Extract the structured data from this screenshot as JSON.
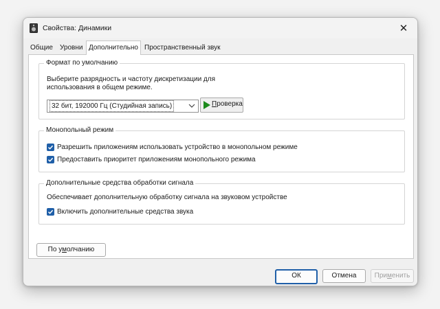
{
  "window": {
    "title": "Свойства: Динамики",
    "close_glyph": "✕"
  },
  "tabs": [
    {
      "label": "Общие"
    },
    {
      "label": "Уровни"
    },
    {
      "label": "Дополнительно",
      "active": true
    },
    {
      "label": "Пространственный звук"
    }
  ],
  "format_group": {
    "legend": "Формат по умолчанию",
    "description_line1": "Выберите разрядность и частоту дискретизации для",
    "description_line2": "использования в общем режиме.",
    "selected_format": "32 бит, 192000 Гц (Студийная запись)",
    "test_button": {
      "prefix": "",
      "underlined": "П",
      "suffix": "роверка"
    }
  },
  "exclusive_group": {
    "legend": "Монопольный режим",
    "options": [
      {
        "label": "Разрешить приложениям использовать устройство в монопольном режиме",
        "checked": true
      },
      {
        "label": "Предоставить приоритет приложениям монопольного режима",
        "checked": true
      }
    ]
  },
  "enhancements_group": {
    "legend": "Дополнительные средства обработки сигнала",
    "description": "Обеспечивает дополнительную обработку сигнала на звуковом устройстве",
    "option": {
      "label": "Включить дополнительные средства звука",
      "checked": true
    }
  },
  "defaults_button": {
    "prefix": "По у",
    "underlined": "м",
    "suffix": "олчанию"
  },
  "footer": {
    "ok": "ОК",
    "cancel": "Отмена",
    "apply": {
      "prefix": "При",
      "underlined": "м",
      "suffix": "енить",
      "enabled": false
    }
  },
  "colors": {
    "accent": "#1f5fa8",
    "play_green": "#1c8a1c"
  },
  "icons": [
    "speaker-icon",
    "close-icon",
    "chevron-down-icon",
    "play-icon",
    "check-icon"
  ]
}
